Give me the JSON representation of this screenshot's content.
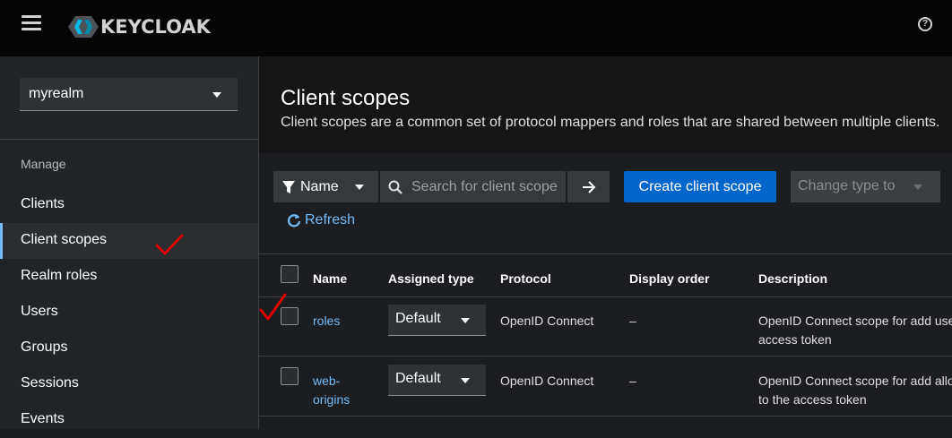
{
  "app": {
    "logo_text": "KEYCLOAK"
  },
  "sidebar": {
    "realm": "myrealm",
    "section": "Manage",
    "items": [
      {
        "label": "Clients"
      },
      {
        "label": "Client scopes"
      },
      {
        "label": "Realm roles"
      },
      {
        "label": "Users"
      },
      {
        "label": "Groups"
      },
      {
        "label": "Sessions"
      },
      {
        "label": "Events"
      }
    ]
  },
  "page": {
    "title": "Client scopes",
    "description": "Client scopes are a common set of protocol mappers and roles that are shared between multiple clients."
  },
  "toolbar": {
    "filter_label": "Name",
    "search_placeholder": "Search for client scope",
    "create_label": "Create client scope",
    "change_type_label": "Change type to",
    "refresh_label": "Refresh"
  },
  "table": {
    "headers": [
      "Name",
      "Assigned type",
      "Protocol",
      "Display order",
      "Description"
    ],
    "rows": [
      {
        "name": "roles",
        "assigned": "Default",
        "protocol": "OpenID Connect",
        "order": "–",
        "desc1": "OpenID Connect scope for add use",
        "desc2": "access token"
      },
      {
        "name1": "web-",
        "name2": "origins",
        "assigned": "Default",
        "protocol": "OpenID Connect",
        "order": "–",
        "desc1": "OpenID Connect scope for add allo",
        "desc2": "to the access token"
      }
    ]
  },
  "colors": {
    "accent": "#0066cc",
    "link": "#73bcf7",
    "annotation": "#e00000"
  }
}
